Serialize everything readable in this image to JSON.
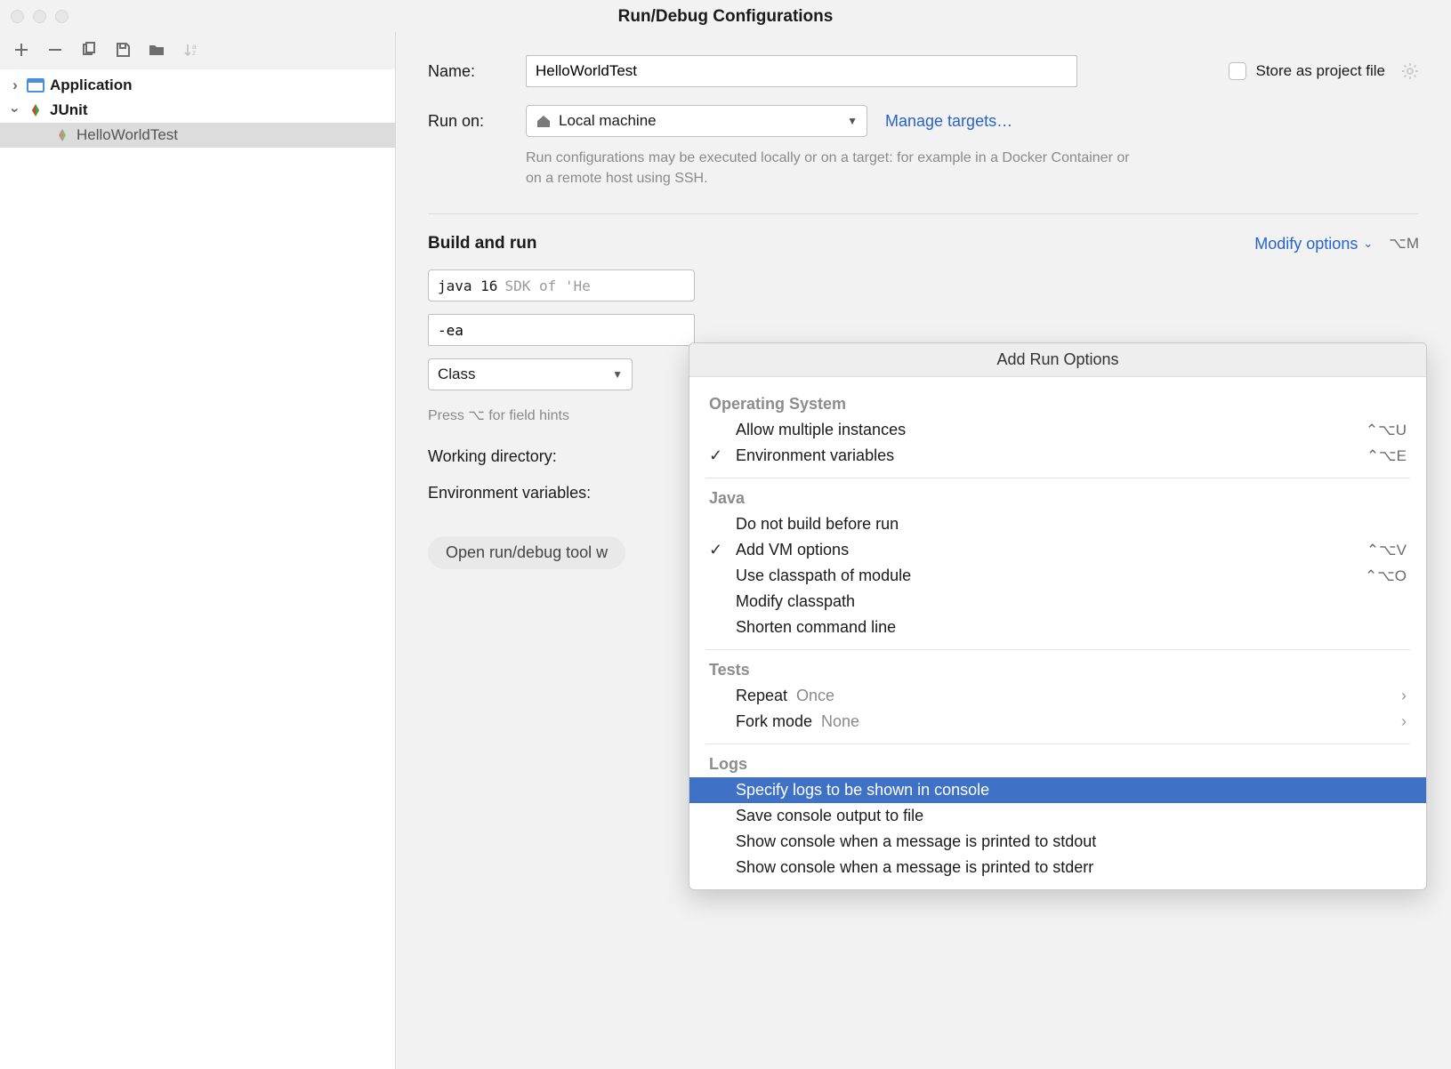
{
  "window": {
    "title": "Run/Debug Configurations"
  },
  "sidebar": {
    "nodes": [
      {
        "label": "Application",
        "expandable": true,
        "expanded": false
      },
      {
        "label": "JUnit",
        "expandable": true,
        "expanded": true
      },
      {
        "label": "HelloWorldTest",
        "child": true,
        "selected": true
      }
    ]
  },
  "form": {
    "name_label": "Name:",
    "name_value": "HelloWorldTest",
    "store_label": "Store as project file",
    "runon_label": "Run on:",
    "runon_value": "Local machine",
    "manage_targets": "Manage targets…",
    "runon_hint": "Run configurations may be executed locally or on a target: for example in a Docker Container or on a remote host using SSH.",
    "build_run": "Build and run",
    "modify_options": "Modify options",
    "modify_shortcut": "⌥M",
    "sdk_main": "java 16",
    "sdk_gray": " SDK of 'He",
    "vm_options": "-ea",
    "class_label": "Class",
    "field_hint": "Press ⌥ for field hints",
    "wd_label": "Working directory:",
    "env_label": "Environment variables:",
    "pill": "Open run/debug tool w"
  },
  "popup": {
    "title": "Add Run Options",
    "groups": [
      {
        "title": "Operating System",
        "items": [
          {
            "label": "Allow multiple instances",
            "checked": false,
            "shortcut": "⌃⌥U"
          },
          {
            "label": "Environment variables",
            "checked": true,
            "shortcut": "⌃⌥E"
          }
        ]
      },
      {
        "title": "Java",
        "items": [
          {
            "label": "Do not build before run",
            "checked": false
          },
          {
            "label": "Add VM options",
            "checked": true,
            "shortcut": "⌃⌥V"
          },
          {
            "label": "Use classpath of module",
            "checked": false,
            "shortcut": "⌃⌥O"
          },
          {
            "label": "Modify classpath",
            "checked": false
          },
          {
            "label": "Shorten command line",
            "checked": false
          }
        ]
      },
      {
        "title": "Tests",
        "items": [
          {
            "label": "Repeat",
            "value": "Once",
            "submenu": true
          },
          {
            "label": "Fork mode",
            "value": "None",
            "submenu": true
          }
        ]
      },
      {
        "title": "Logs",
        "items": [
          {
            "label": "Specify logs to be shown in console",
            "selected": true
          },
          {
            "label": "Save console output to file"
          },
          {
            "label": "Show console when a message is printed to stdout"
          },
          {
            "label": "Show console when a message is printed to stderr"
          }
        ]
      }
    ]
  }
}
